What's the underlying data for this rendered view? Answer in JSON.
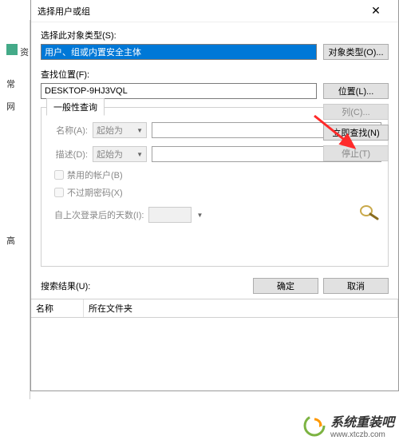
{
  "bg": {
    "icon_label": "资",
    "tabs": [
      "常",
      "网"
    ],
    "items": [
      "高"
    ]
  },
  "dialog": {
    "title": "选择用户或组",
    "object_type_label": "选择此对象类型(S):",
    "object_type_value": "用户、组或内置安全主体",
    "object_types_btn": "对象类型(O)...",
    "location_label": "查找位置(F):",
    "location_value": "DESKTOP-9HJ3VQL",
    "locations_btn": "位置(L)...",
    "common_tab": "一般性查询",
    "name_label": "名称(A):",
    "desc_label": "描述(D):",
    "combo_text": "起始为",
    "cb_disabled": "禁用的帐户(B)",
    "cb_noexpire": "不过期密码(X)",
    "days_label": "自上次登录后的天数(I):",
    "columns_btn": "列(C)...",
    "search_now_btn": "立即查找(N)",
    "stop_btn": "停止(T)",
    "ok_btn": "确定",
    "cancel_btn": "取消",
    "results_label": "搜索结果(U):",
    "col_name": "名称",
    "col_folder": "所在文件夹"
  },
  "watermark": {
    "title": "系统重装吧",
    "url": "www.xtczb.com"
  }
}
